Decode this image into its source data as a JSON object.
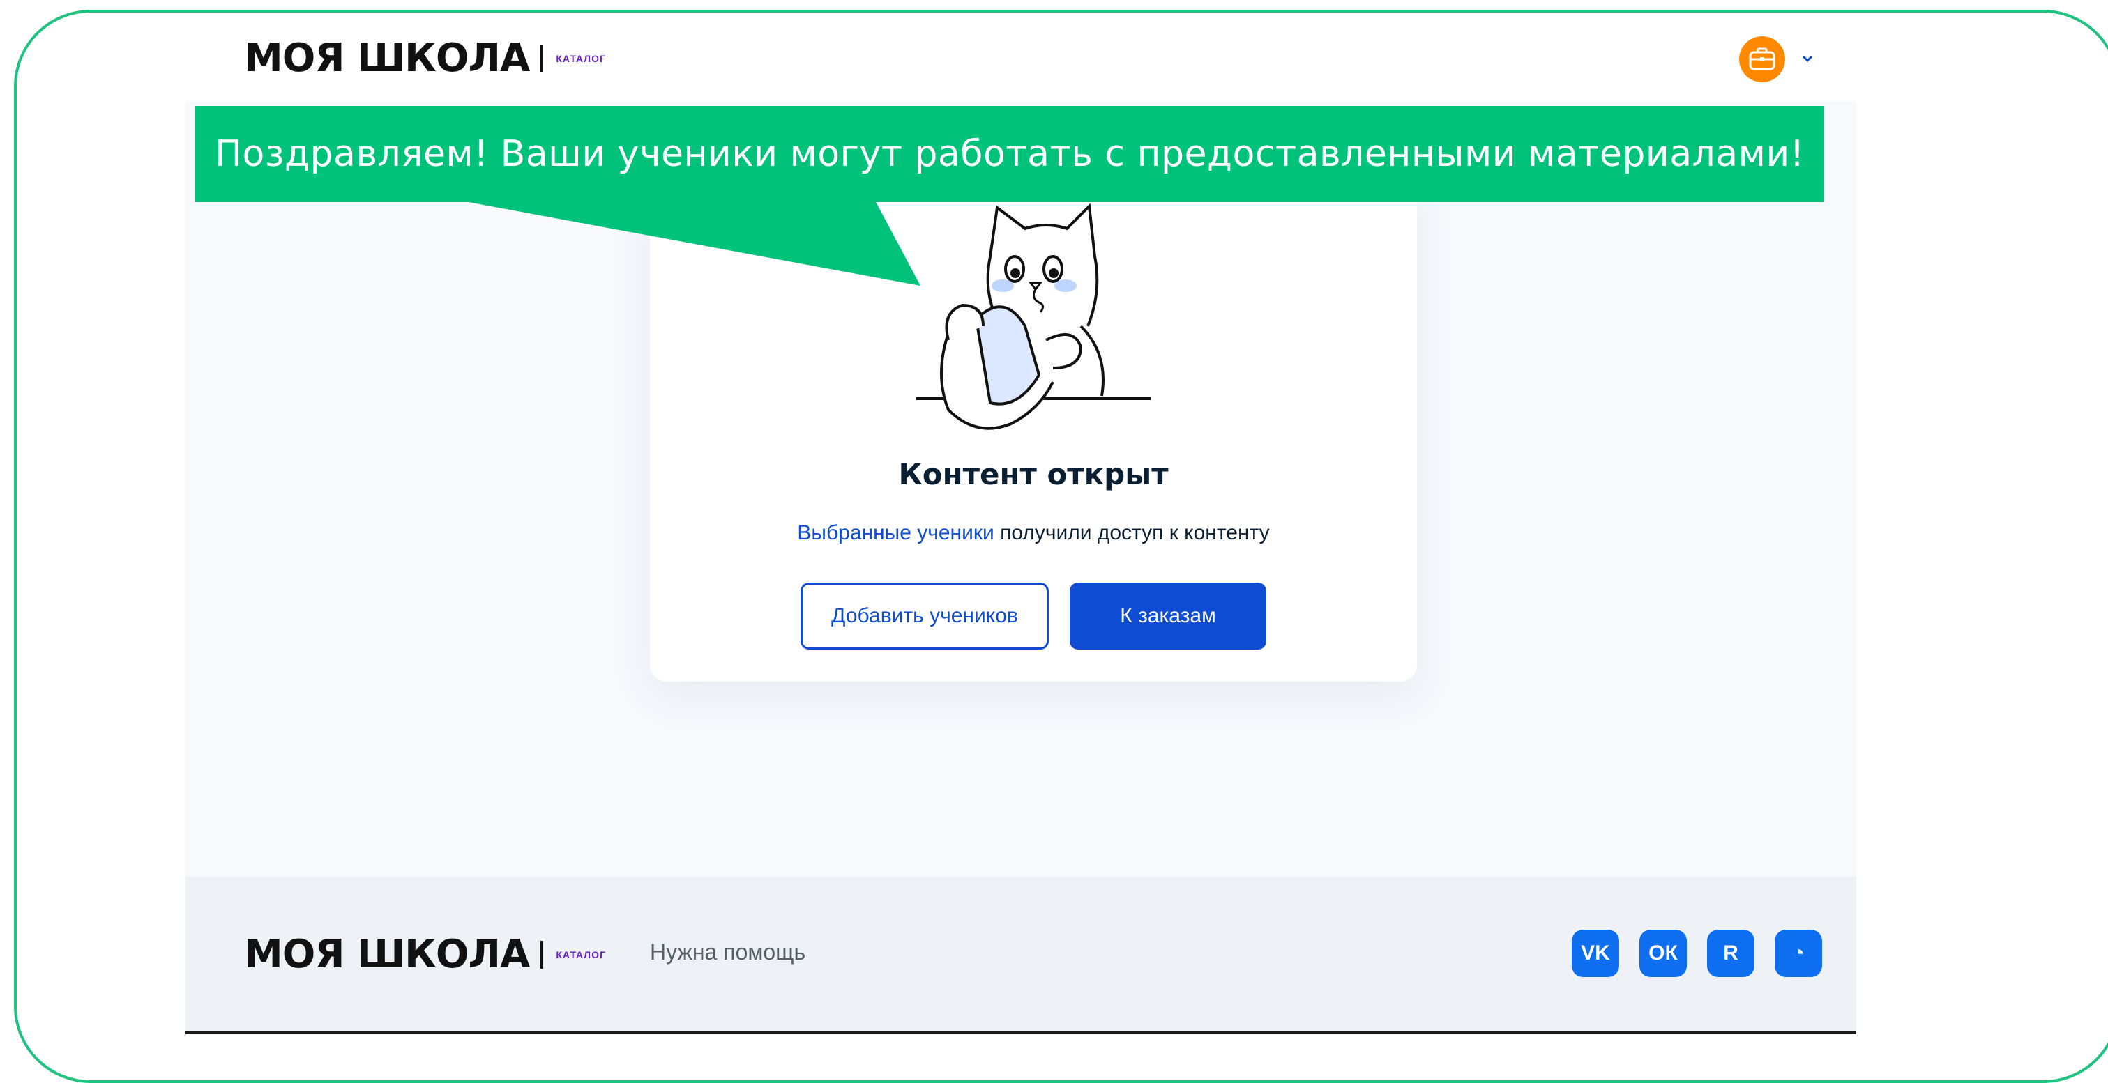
{
  "header": {
    "logo_main": "МОЯ ШКОЛА",
    "logo_sub": "КАТАЛОГ",
    "account_icon": "briefcase-icon",
    "account_chevron_icon": "chevron-down-icon"
  },
  "banner": {
    "text": "Поздравляем! Ваши ученики могут работать с предоставленными материалами!"
  },
  "card": {
    "illustration": "cat-with-tablet",
    "title": "Контент открыт",
    "text_link": "Выбранные ученики",
    "text_rest": " получили доступ к контенту",
    "add_students_label": "Добавить учеников",
    "to_orders_label": "К заказам"
  },
  "footer": {
    "logo_main": "МОЯ ШКОЛА",
    "logo_sub": "КАТАЛОГ",
    "help_label": "Нужна помощь",
    "social": [
      {
        "icon": "vk-icon",
        "glyph": "VK"
      },
      {
        "icon": "odnoklassniki-icon",
        "glyph": "ОК"
      },
      {
        "icon": "rutube-icon",
        "glyph": "R"
      },
      {
        "icon": "sferum-icon",
        "glyph": "◔"
      }
    ]
  },
  "colors": {
    "accent": "#0d4cd3",
    "banner": "#00c27a",
    "frame": "#1fc27f",
    "account": "#ff8a00"
  }
}
